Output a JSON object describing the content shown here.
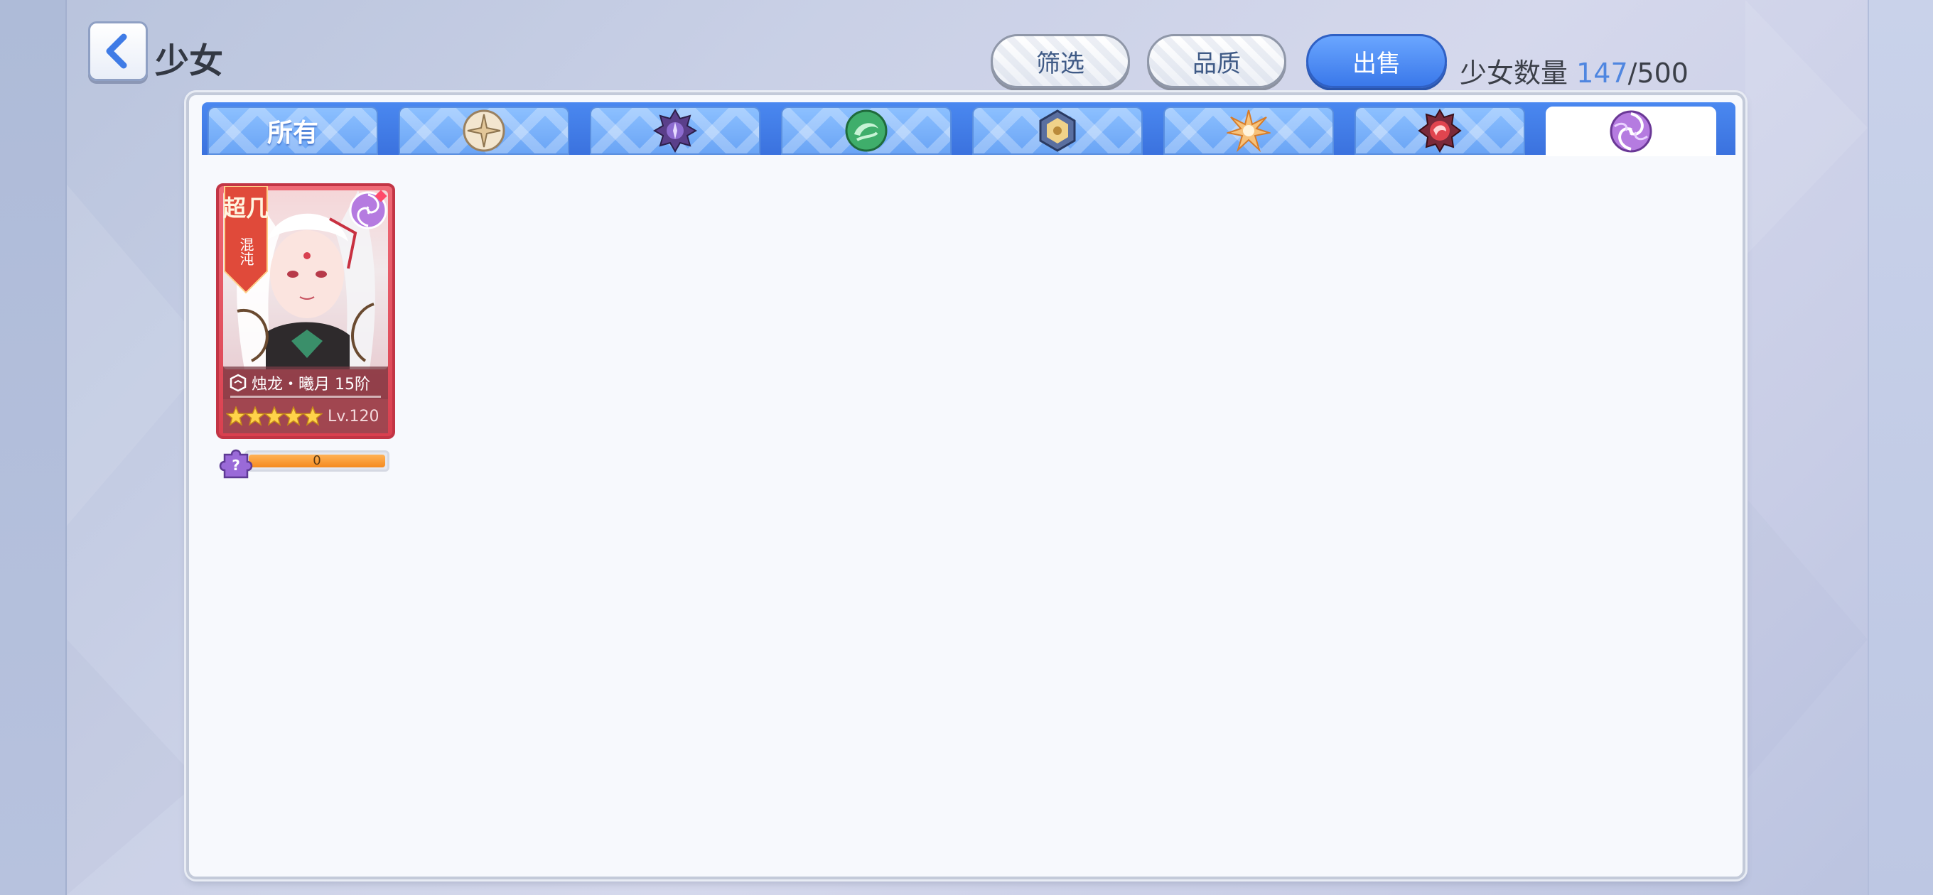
{
  "header": {
    "back_icon": "chevron-left-icon",
    "title": "少女"
  },
  "toolbar": {
    "filter_label": "筛选",
    "quality_label": "品质",
    "sell_label": "出售",
    "count_label": "少女数量",
    "count_current": "147",
    "count_max": "/500"
  },
  "tabs": [
    {
      "label": "所有",
      "icon": null,
      "active": false
    },
    {
      "label": "",
      "icon": "light-element-icon",
      "active": false
    },
    {
      "label": "",
      "icon": "dark-element-icon",
      "active": false
    },
    {
      "label": "",
      "icon": "wind-element-icon",
      "active": false
    },
    {
      "label": "",
      "icon": "earth-element-icon",
      "active": false
    },
    {
      "label": "",
      "icon": "fire-star-element-icon",
      "active": false
    },
    {
      "label": "",
      "icon": "dragon-element-icon",
      "active": false
    },
    {
      "label": "",
      "icon": "chaos-element-icon",
      "active": true
    }
  ],
  "cards": [
    {
      "rank": "超几",
      "element_text": "混沌",
      "element_icon": "chaos-element-icon",
      "name": "烛龙・曦月 15阶",
      "stars": 5,
      "level": "Lv.120",
      "shard_count": "0",
      "shard_progress": 1.0
    }
  ],
  "colors": {
    "accent_blue": "#3b72de",
    "card_red": "#d9404f",
    "progress_orange": "#f58a1f",
    "count_blue": "#4f86e0"
  }
}
